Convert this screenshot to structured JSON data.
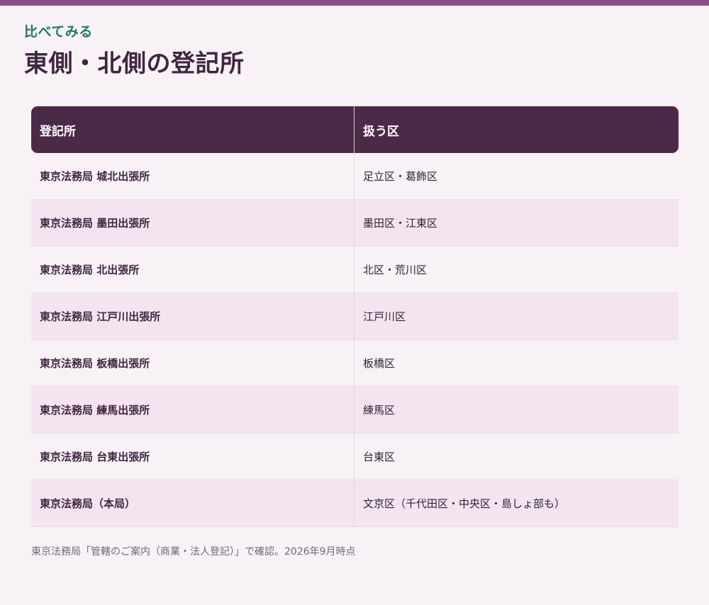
{
  "header": {
    "eyebrow": "比べてみる",
    "title": "東側・北側の登記所"
  },
  "table": {
    "columns": [
      "登記所",
      "扱う区"
    ],
    "rows": [
      {
        "office": "東京法務局 城北出張所",
        "wards": "足立区・葛飾区"
      },
      {
        "office": "東京法務局 墨田出張所",
        "wards": "墨田区・江東区"
      },
      {
        "office": "東京法務局 北出張所",
        "wards": "北区・荒川区"
      },
      {
        "office": "東京法務局 江戸川出張所",
        "wards": "江戸川区"
      },
      {
        "office": "東京法務局 板橋出張所",
        "wards": "板橋区"
      },
      {
        "office": "東京法務局 練馬出張所",
        "wards": "練馬区"
      },
      {
        "office": "東京法務局 台東出張所",
        "wards": "台東区"
      },
      {
        "office": "東京法務局（本局）",
        "wards": "文京区（千代田区・中央区・島しょ部も）"
      }
    ]
  },
  "footer": {
    "source": "東京法務局「管轄のご案内（商業・法人登記）」で確認。2026年9月時点"
  },
  "colors": {
    "accent_bar": "#8b4f86",
    "eyebrow": "#1f7a6c",
    "header_bg": "#4b2a47",
    "row_alt": "#f4e4f0",
    "background": "#f8f2f7"
  }
}
